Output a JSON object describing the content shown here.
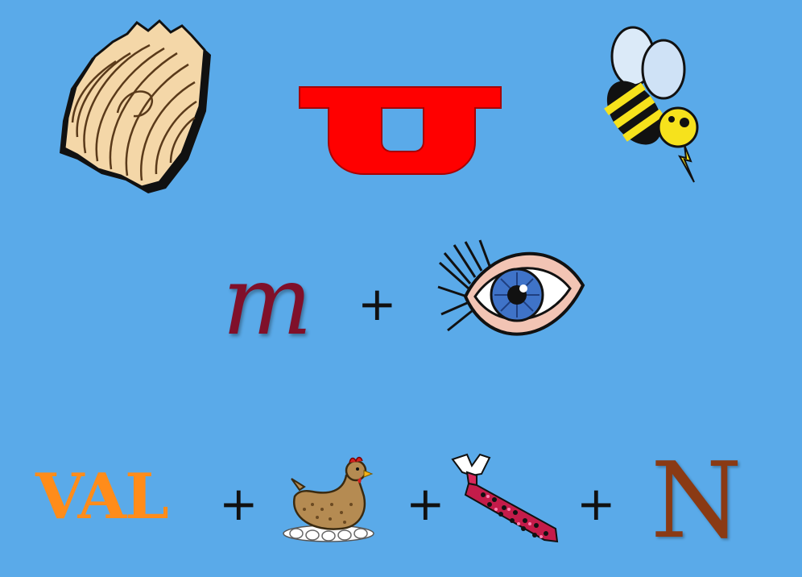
{
  "puzzle": {
    "row2": {
      "letter": "m",
      "plus": "+"
    },
    "row3": {
      "word": "VAL",
      "plus_1": "+",
      "plus_2": "+",
      "plus_3": "+",
      "letter": "N"
    }
  },
  "icons": {
    "row1": [
      "wood-plank-icon",
      "magnet-icon",
      "bee-icon"
    ],
    "row2": [
      "eye-icon"
    ],
    "row3": [
      "hen-icon",
      "necktie-icon"
    ]
  },
  "colors": {
    "background": "#5aaae9",
    "letter_m": "#80102a",
    "word_val": "#ff8c1a",
    "letter_n": "#8a3a14",
    "magnet": "#ff0000"
  }
}
